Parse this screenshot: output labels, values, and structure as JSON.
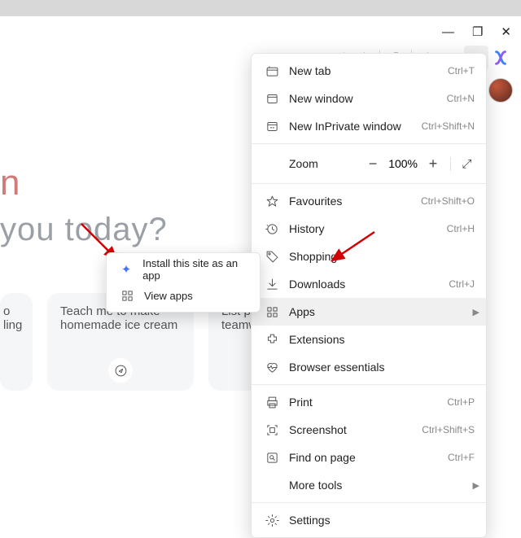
{
  "window_controls": {
    "min": "—",
    "max": "❐",
    "close": "✕"
  },
  "toolbar": {
    "keys": "keys-icon",
    "star": "star-icon",
    "ext": "ext-icon",
    "fav": "fav-icon",
    "collect": "collect-icon",
    "more": "…"
  },
  "hero": {
    "accent": "n",
    "line": "you today?"
  },
  "cards": [
    {
      "text": "o\nling"
    },
    {
      "text": "Teach me to make homemade ice cream"
    },
    {
      "text": "List pow\nmy resu\nteamwo"
    }
  ],
  "menu": {
    "new_tab": {
      "label": "New tab",
      "short": "Ctrl+T"
    },
    "new_window": {
      "label": "New window",
      "short": "Ctrl+N"
    },
    "inprivate": {
      "label": "New InPrivate window",
      "short": "Ctrl+Shift+N"
    },
    "zoom": {
      "label": "Zoom",
      "value": "100%"
    },
    "favourites": {
      "label": "Favourites",
      "short": "Ctrl+Shift+O"
    },
    "history": {
      "label": "History",
      "short": "Ctrl+H"
    },
    "shopping": {
      "label": "Shopping"
    },
    "downloads": {
      "label": "Downloads",
      "short": "Ctrl+J"
    },
    "apps": {
      "label": "Apps"
    },
    "extensions": {
      "label": "Extensions"
    },
    "essentials": {
      "label": "Browser essentials"
    },
    "print": {
      "label": "Print",
      "short": "Ctrl+P"
    },
    "screenshot": {
      "label": "Screenshot",
      "short": "Ctrl+Shift+S"
    },
    "find": {
      "label": "Find on page",
      "short": "Ctrl+F"
    },
    "more_tools": {
      "label": "More tools"
    },
    "settings": {
      "label": "Settings"
    }
  },
  "submenu": {
    "install": {
      "label": "Install this site as an app"
    },
    "view": {
      "label": "View apps"
    }
  }
}
